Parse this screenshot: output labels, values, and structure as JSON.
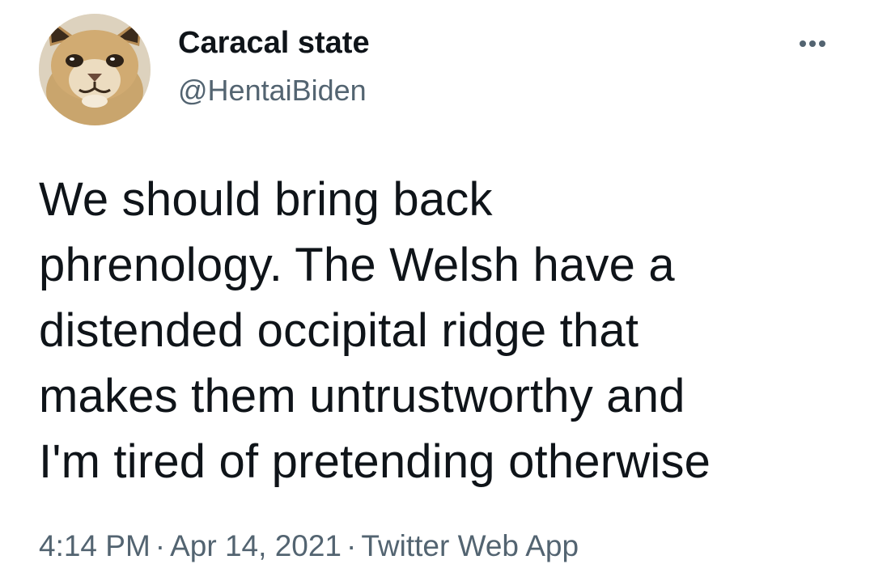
{
  "author": {
    "display_name": "Caracal state",
    "handle": "@HentaiBiden",
    "avatar_icon": "caracal-avatar"
  },
  "tweet": {
    "text": "We should bring back\nphrenology. The Welsh have a\ndistended occipital ridge that\nmakes them untrustworthy and\nI'm tired of pretending otherwise"
  },
  "meta": {
    "time": "4:14 PM",
    "date": "Apr 14, 2021",
    "source": "Twitter Web App",
    "separator": "·"
  },
  "icons": {
    "more": "more-dots-icon"
  },
  "colors": {
    "text_primary": "#0f1419",
    "text_secondary": "#536471",
    "background": "#ffffff"
  }
}
